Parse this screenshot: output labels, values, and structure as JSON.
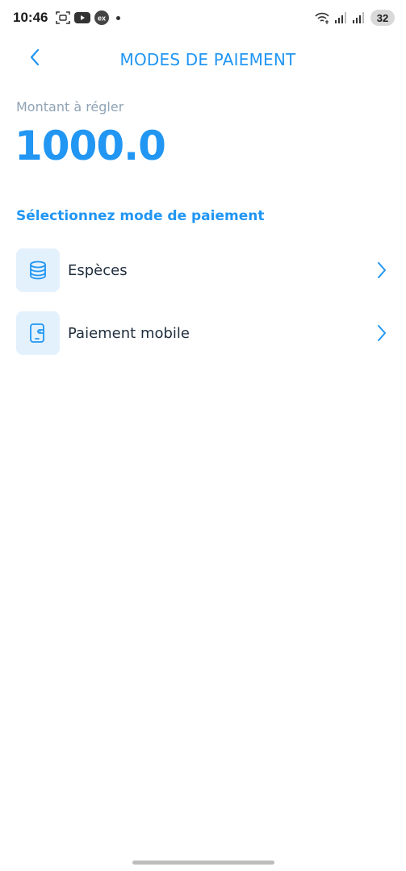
{
  "status_bar": {
    "time": "10:46",
    "battery": "32",
    "icons": [
      "screenshot-icon",
      "youtube-icon",
      "ex-app-icon",
      "notification-dot",
      "wifi-icon",
      "signal-icon",
      "signal-icon",
      "battery-icon"
    ]
  },
  "header": {
    "title": "MODES DE PAIEMENT",
    "back_icon": "chevron-left-icon"
  },
  "amount": {
    "label": "Montant à régler",
    "value": "1000.0"
  },
  "section": {
    "title": "Sélectionnez mode de paiement"
  },
  "methods": [
    {
      "label": "Espèces",
      "icon": "coins-icon"
    },
    {
      "label": "Paiement mobile",
      "icon": "mobile-wallet-icon"
    }
  ],
  "colors": {
    "accent": "#2196f3",
    "icon_bg": "#e3f1fd",
    "label_text": "#1f2d3d",
    "muted_text": "#8fa3b5"
  }
}
